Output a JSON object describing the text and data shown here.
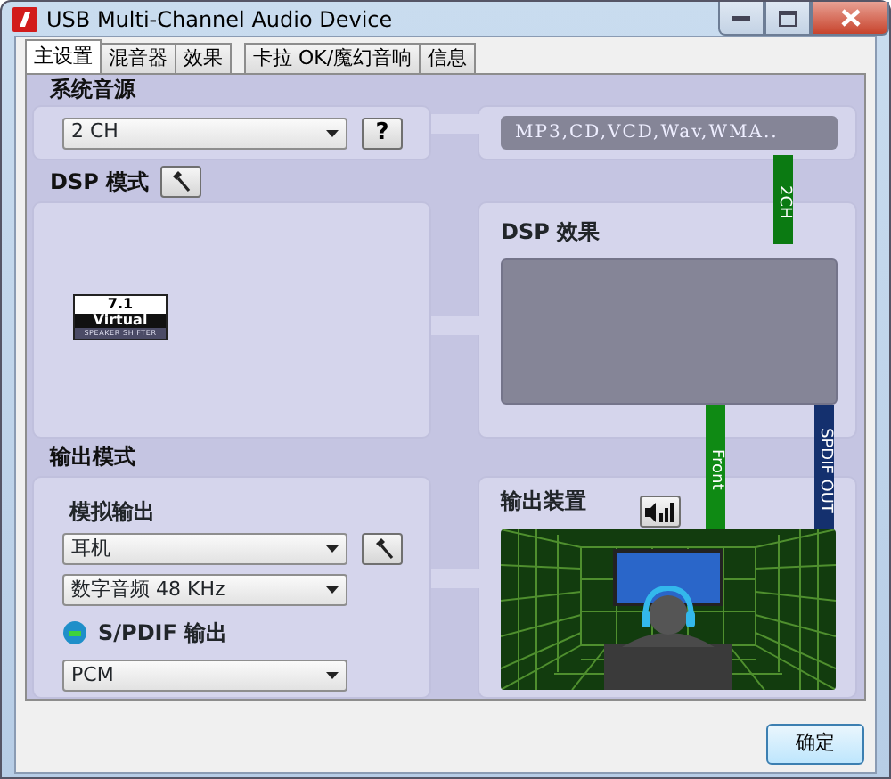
{
  "window": {
    "title": "USB Multi-Channel Audio Device"
  },
  "tabs": [
    {
      "label": "主设置",
      "selected": true
    },
    {
      "label": "混音器",
      "selected": false
    },
    {
      "label": "效果",
      "selected": false
    },
    {
      "label": "卡拉 OK/魔幻音响",
      "selected": false
    },
    {
      "label": "信息",
      "selected": false
    }
  ],
  "system_source": {
    "label": "系统音源",
    "value": "2 CH",
    "help": "?"
  },
  "supported_formats": "MP3,CD,VCD,Wav,WMA..",
  "dsp_mode": {
    "label": "DSP 模式"
  },
  "virtual_logo": {
    "line_1": "7.1",
    "line_2": "Virtual",
    "line_3": "SPEAKER SHIFTER"
  },
  "dsp_effect": {
    "label": "DSP 效果"
  },
  "connectors": [
    {
      "label": "2CH",
      "color": "#0b7a12"
    },
    {
      "label": "Front",
      "color": "#0f8a14"
    },
    {
      "label": "SPDIF OUT",
      "color": "#14306e"
    }
  ],
  "output_mode": {
    "label": "输出模式",
    "analog_label": "模拟输出",
    "analog_value": "耳机",
    "digital_value": "数字音频 48 KHz",
    "spdif_label": "S/PDIF 输出",
    "spdif_on": true,
    "spdif_value": "PCM"
  },
  "output_device": {
    "label": "输出装置"
  },
  "buttons": [
    {
      "label": "确定"
    }
  ]
}
